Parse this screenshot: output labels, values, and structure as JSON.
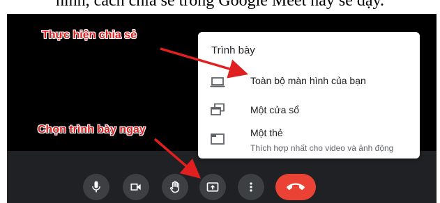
{
  "page": {
    "top_text": "hình, cách chia sẻ trong Google Meet này sẽ dạy."
  },
  "annotations": {
    "share_note": "Thực hiện chia sẻ",
    "present_note": "Chọn trình bày ngay",
    "color": "#e02020"
  },
  "present_menu": {
    "title": "Trình bày",
    "items": [
      {
        "label": "Toàn bộ màn hình của bạn",
        "icon": "laptop-icon"
      },
      {
        "label": "Một cửa sổ",
        "icon": "window-stack-icon"
      },
      {
        "label": "Một thẻ",
        "sublabel": "Thích hợp nhất cho video và ảnh động",
        "icon": "browser-tab-icon"
      }
    ]
  },
  "controls": [
    {
      "name": "microphone",
      "icon": "microphone-icon"
    },
    {
      "name": "camera",
      "icon": "video-camera-icon"
    },
    {
      "name": "raise-hand",
      "icon": "hand-icon"
    },
    {
      "name": "present-now",
      "icon": "present-screen-icon"
    },
    {
      "name": "more-options",
      "icon": "more-vert-icon"
    },
    {
      "name": "leave-call",
      "icon": "hang-up-icon",
      "color": "#ea4335"
    }
  ],
  "colors": {
    "meeting_background": "#000000",
    "toolbar_background": "#202124",
    "button_background": "#3c4043",
    "end_call": "#ea4335"
  }
}
